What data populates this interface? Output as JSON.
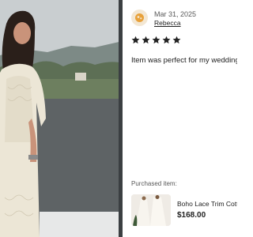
{
  "review": {
    "date": "Mar 31, 2025",
    "reviewer": "Rebecca",
    "rating": 5,
    "text": "Item was perfect for my wedding"
  },
  "purchase": {
    "label": "Purchased item:",
    "title": "Boho Lace Trim Cotton Dress",
    "price": "$168.00"
  },
  "icons": {
    "avatar": "avatar-icon",
    "star": "star-icon"
  },
  "colors": {
    "star": "#222222",
    "avatar_bg": "#f3e7d3",
    "avatar_icon": "#e8a13a"
  }
}
